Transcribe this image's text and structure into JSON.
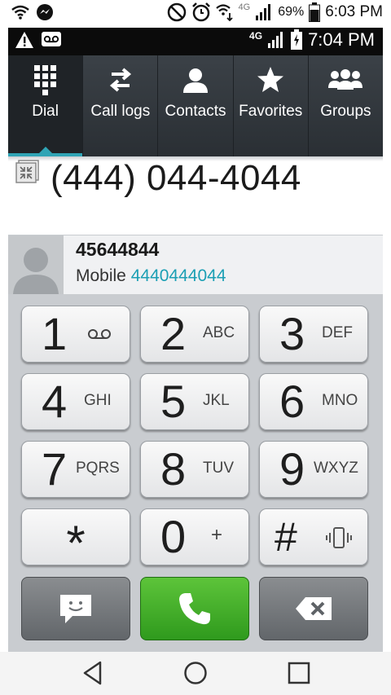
{
  "outer_status": {
    "battery": "69%",
    "time": "6:03 PM",
    "network": "4G"
  },
  "inner_status": {
    "network": "4G",
    "time": "7:04 PM"
  },
  "tabs": [
    {
      "label": "Dial",
      "icon": "dialpad-icon",
      "active": true
    },
    {
      "label": "Call logs",
      "icon": "call-logs-icon",
      "active": false
    },
    {
      "label": "Contacts",
      "icon": "contacts-icon",
      "active": false
    },
    {
      "label": "Favorites",
      "icon": "star-icon",
      "active": false
    },
    {
      "label": "Groups",
      "icon": "groups-icon",
      "active": false
    }
  ],
  "dialed_number": "(444) 044-4044",
  "suggestion": {
    "name": "45644844",
    "type": "Mobile",
    "number": "4440444044"
  },
  "keys": [
    {
      "digit": "1",
      "letters": ""
    },
    {
      "digit": "2",
      "letters": "ABC"
    },
    {
      "digit": "3",
      "letters": "DEF"
    },
    {
      "digit": "4",
      "letters": "GHI"
    },
    {
      "digit": "5",
      "letters": "JKL"
    },
    {
      "digit": "6",
      "letters": "MNO"
    },
    {
      "digit": "7",
      "letters": "PQRS"
    },
    {
      "digit": "8",
      "letters": "TUV"
    },
    {
      "digit": "9",
      "letters": "WXYZ"
    },
    {
      "digit": "*",
      "letters": ""
    },
    {
      "digit": "0",
      "letters": "+"
    },
    {
      "digit": "#",
      "letters": ""
    }
  ],
  "colors": {
    "accent": "#2fa4b5",
    "call": "#3fae28",
    "tab_bg": "#343a40"
  }
}
